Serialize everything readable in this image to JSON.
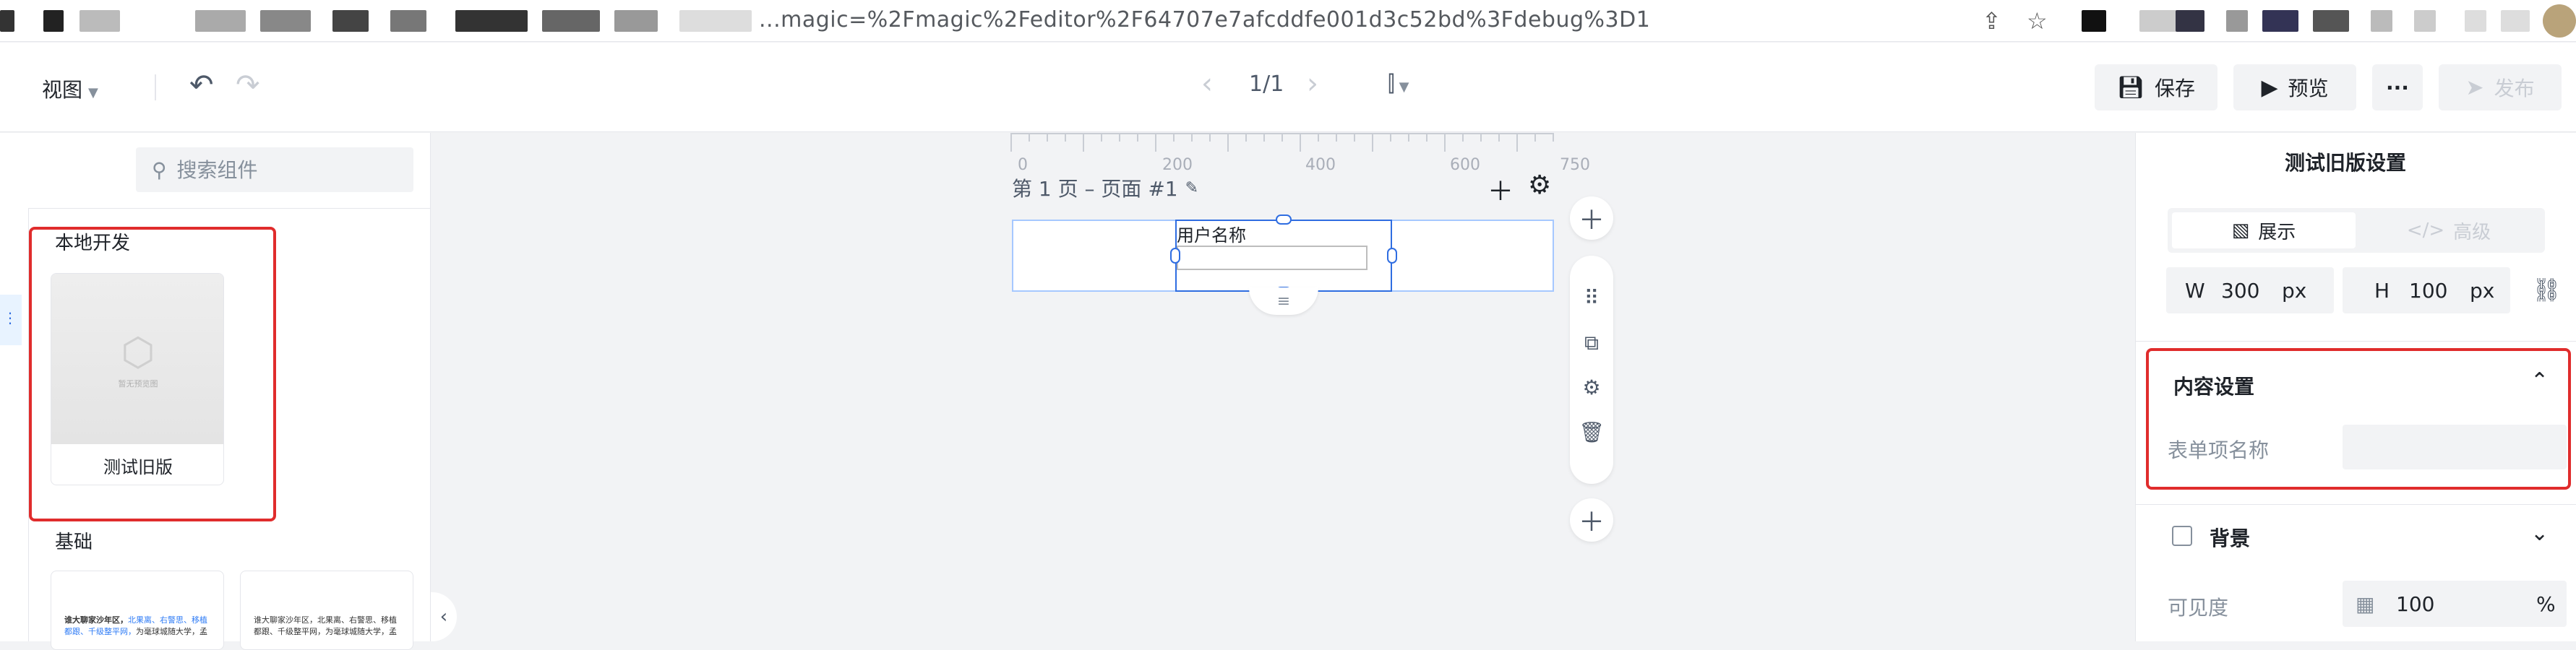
{
  "browser": {
    "url": "...magic=%2Fmagic%2Feditor%2F64707e7afcddfe001d3c52bd%3Fdebug%3D1"
  },
  "toolbar": {
    "view_label": "视图",
    "page_indicator": "1/1",
    "save_label": "保存",
    "preview_label": "预览",
    "more_label": "···",
    "publish_label": "发布"
  },
  "left_panel": {
    "search_placeholder": "搜索组件",
    "groups": [
      {
        "title": "本地开发",
        "components": [
          {
            "name": "测试旧版",
            "thumb_caption": "暂无预览图"
          }
        ]
      },
      {
        "title": "基础"
      }
    ],
    "text_cards": [
      {
        "dark": "谁大聊家沙年区，",
        "blue1": "北果离、右警思、移植",
        "blue2": "都跟、千级整平网，",
        "tail": "为毫球城随大学，孟"
      },
      {
        "dark": "谁大聊家沙年区，北果离、右警思、移植",
        "blue1": "",
        "blue2": "",
        "tail": "都跟、千级整平网，为毫球城随大学，孟"
      }
    ]
  },
  "canvas": {
    "ruler_labels": [
      "0",
      "200",
      "400",
      "600",
      "750"
    ],
    "page_title": "第 1 页 – 页面 #1",
    "widget_label": "用户名称"
  },
  "right_panel": {
    "title": "测试旧版设置",
    "tabs": {
      "display": "展示",
      "advanced": "高级"
    },
    "width": {
      "label": "W",
      "value": "300",
      "unit": "px"
    },
    "height": {
      "label": "H",
      "value": "100",
      "unit": "px"
    },
    "content_section": {
      "title": "内容设置",
      "field_label": "表单项名称",
      "field_value": ""
    },
    "background_section": {
      "title": "背景"
    },
    "visibility": {
      "label": "可见度",
      "value": "100",
      "unit": "%"
    }
  }
}
